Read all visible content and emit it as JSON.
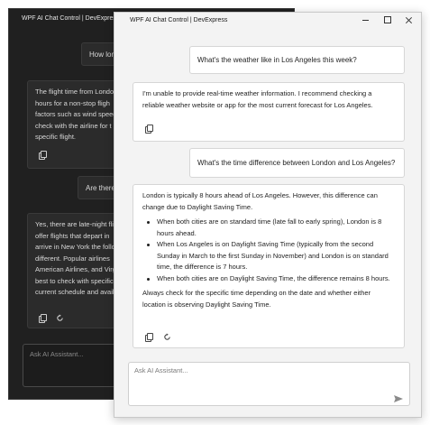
{
  "back_window": {
    "title": "WPF AI Chat Control | DevExpress",
    "user_msg_1": "How long",
    "ai_msg_1": [
      "The flight time from Londo",
      "hours for a non-stop fligh",
      "factors such as wind speed",
      "check with the airline for t",
      "specific flight."
    ],
    "user_msg_2": "Are there",
    "ai_msg_2": [
      "Yes, there are late-night fli",
      "offer flights that depart in",
      "arrive in New York the follo",
      "different. Popular airlines",
      "American Airlines, and Virg",
      "best to check with specific",
      "current schedule and avail"
    ],
    "input_placeholder": "Ask AI Assistant..."
  },
  "front_window": {
    "title": "WPF AI Chat Control | DevExpress",
    "messages": [
      {
        "role": "user",
        "text": "What's the weather like in Los Angeles this week?"
      },
      {
        "role": "assistant",
        "lines": [
          "I'm unable to provide real-time weather information. I recommend checking a",
          "reliable weather website or app for the most current forecast for Los Angeles."
        ]
      },
      {
        "role": "user",
        "text": "What's the time difference between London and Los Angeles?"
      },
      {
        "role": "assistant",
        "intro": [
          "London is typically 8 hours ahead of Los Angeles. However, this difference can",
          "change due to Daylight Saving Time."
        ],
        "bullets": [
          [
            "When both cities are on standard time (late fall to early spring), London is 8",
            "hours ahead."
          ],
          [
            "When Los Angeles is on Daylight Saving Time (typically from the second",
            "Sunday in March to the first Sunday in November) and London is on standard",
            "time, the difference is 7 hours."
          ],
          [
            "When both cities are on Daylight Saving Time, the difference remains 8 hours."
          ]
        ],
        "outro": [
          "Always check for the specific time depending on the date and whether either",
          "location is observing Daylight Saving Time."
        ]
      }
    ],
    "input_placeholder": "Ask AI Assistant...",
    "input_value": ""
  },
  "colors": {
    "dark_bg": "#202020",
    "light_bg": "#f3f3f3",
    "bubble_light": "#ffffff",
    "bubble_dark": "#2b2b2b"
  },
  "icons": [
    "copy-icon",
    "regenerate-icon",
    "send-icon",
    "minimize-icon",
    "maximize-icon",
    "close-icon"
  ]
}
